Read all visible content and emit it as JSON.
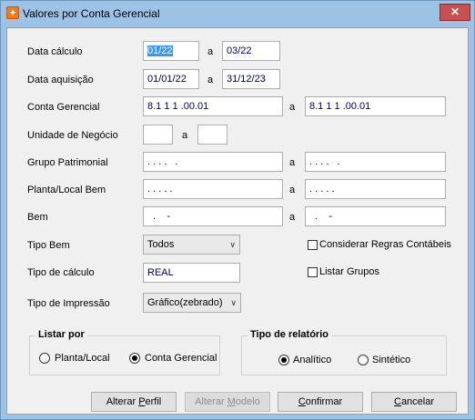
{
  "window": {
    "title": "Valores por Conta Gerencial",
    "close_glyph": "✕",
    "app_icon": "app-icon"
  },
  "form": {
    "data_calculo": {
      "label": "Data cálculo",
      "from": "01/22",
      "sep": "a",
      "to": "03/22"
    },
    "data_aquisicao": {
      "label": "Data aquisição",
      "from": "01/01/22",
      "sep": "a",
      "to": "31/12/23"
    },
    "conta_gerencial": {
      "label": "Conta Gerencial",
      "from": "8.1 1 1 .00.01",
      "sep": "a",
      "to": "8.1 1 1 .00.01"
    },
    "unidade_negocio": {
      "label": "Unidade de Negócio",
      "from": "",
      "sep": "a",
      "to": ""
    },
    "grupo_patrimonial": {
      "label": "Grupo Patrimonial",
      "from": ". . . .   .",
      "sep": "a",
      "to": ". . . .   ."
    },
    "planta_local": {
      "label": "Planta/Local Bem",
      "from": ". . . . .",
      "sep": "a",
      "to": ". . . . ."
    },
    "bem": {
      "label": "Bem",
      "from": "  .    -",
      "sep": "a",
      "to": "  .    -"
    },
    "tipo_bem": {
      "label": "Tipo Bem",
      "value": "Todos"
    },
    "tipo_calculo": {
      "label": "Tipo de cálculo",
      "value": "REAL"
    },
    "tipo_impressao": {
      "label": "Tipo de Impressão",
      "value": "Gráfico(zebrado)"
    },
    "considerar_regras": {
      "label": "Considerar Regras Contábeis",
      "checked": false
    },
    "listar_grupos": {
      "label": "Listar Grupos",
      "checked": false
    }
  },
  "listar_por": {
    "title": "Listar por",
    "options": [
      {
        "label": "Planta/Local",
        "selected": false
      },
      {
        "label": "Conta Gerencial",
        "selected": true
      }
    ]
  },
  "tipo_relatorio": {
    "title": "Tipo de relatório",
    "options": [
      {
        "label": "Analítico",
        "selected": true
      },
      {
        "label": "Sintético",
        "selected": false
      }
    ]
  },
  "buttons": {
    "alterar_perfil": {
      "pre": "Alterar ",
      "ul": "P",
      "post": "erfil",
      "enabled": true
    },
    "alterar_modelo": {
      "pre": "Alterar ",
      "ul": "M",
      "post": "odelo",
      "enabled": false
    },
    "confirmar": {
      "pre": "",
      "ul": "C",
      "post": "onfirmar",
      "enabled": true
    },
    "cancelar": {
      "pre": "",
      "ul": "C",
      "post": "ancelar",
      "enabled": true
    }
  }
}
